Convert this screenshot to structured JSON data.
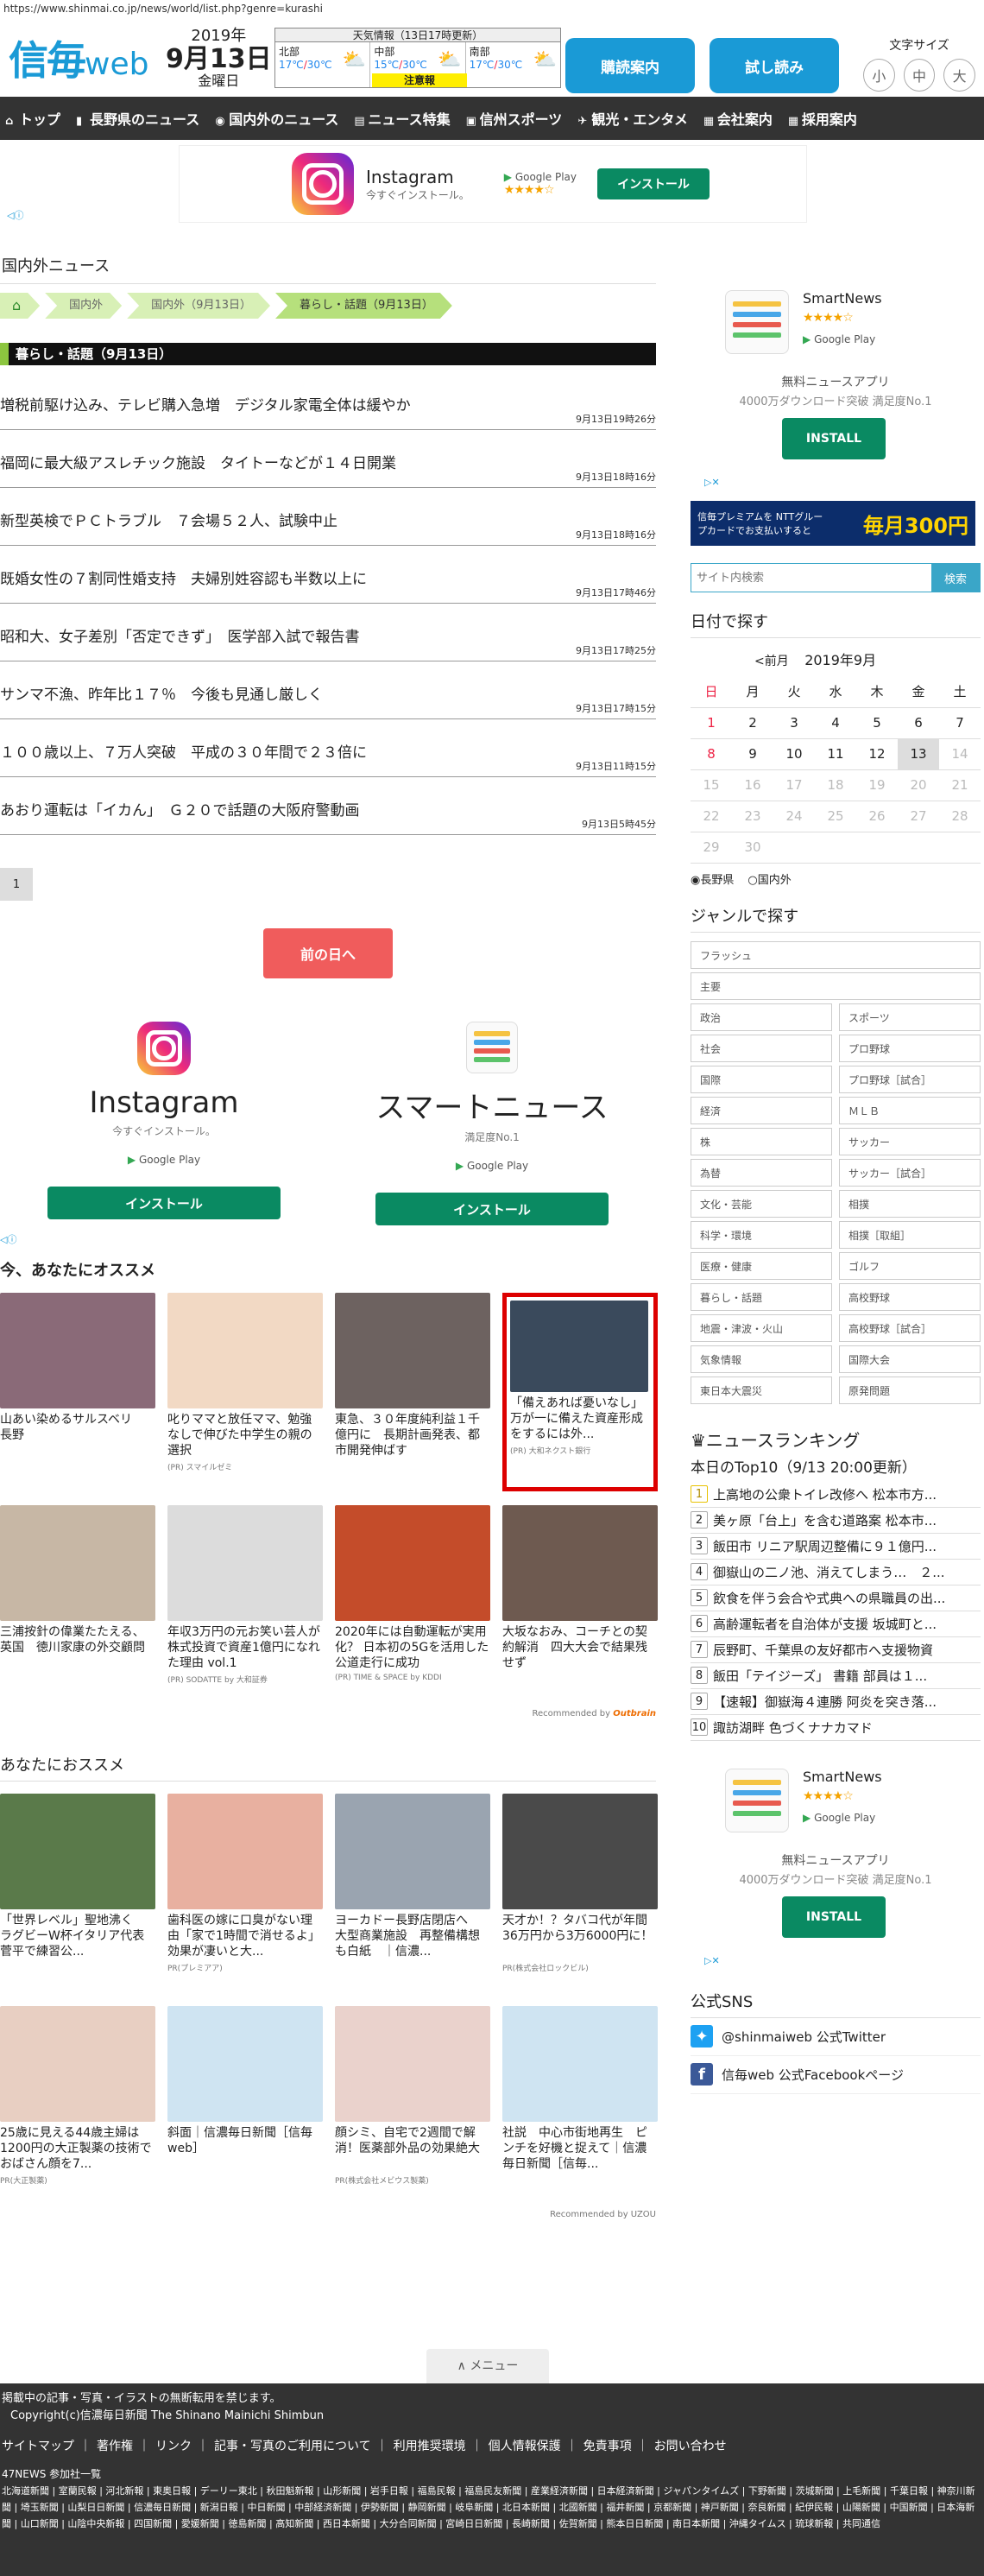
{
  "url": "https://www.shinmai.co.jp/news/world/list.php?genre=kurashi",
  "header": {
    "logo_main": "信毎",
    "logo_sub": "web",
    "year": "2019年",
    "monthday": "9月13日",
    "weekday": "金曜日",
    "weather_title": "天気情報（13日17時更新）",
    "weather": [
      {
        "area": "北部",
        "hi": "17℃",
        "lo": "30℃"
      },
      {
        "area": "中部",
        "hi": "15℃",
        "lo": "30℃"
      },
      {
        "area": "南部",
        "hi": "17℃",
        "lo": "30℃"
      }
    ],
    "weather_alert": "注意報",
    "btn_subscribe": "購読案内",
    "btn_trial": "試し読み",
    "fontsize_label": "文字サイズ",
    "fontsize_small": "小",
    "fontsize_mid": "中",
    "fontsize_large": "大"
  },
  "nav": [
    "トップ",
    "長野県のニュース",
    "国内外のニュース",
    "ニュース特集",
    "信州スポーツ",
    "観光・エンタメ",
    "会社案内",
    "採用案内"
  ],
  "banner_ad": {
    "name": "Instagram",
    "desc": "今すぐインストール。",
    "store": "Google Play",
    "rating": "★★★★☆",
    "install": "インストール"
  },
  "main": {
    "section_title": "国内外ニュース",
    "breadcrumbs": [
      "⌂",
      "国内外",
      "国内外（9月13日）",
      "暮らし・話題（9月13日）"
    ],
    "category_heading": "暮らし・話題（9月13日）",
    "news": [
      {
        "title": "増税前駆け込み、テレビ購入急増　デジタル家電全体は緩やか",
        "time": "9月13日19時26分"
      },
      {
        "title": "福岡に最大級アスレチック施設　タイトーなどが１４日開業",
        "time": "9月13日18時16分"
      },
      {
        "title": "新型英検でＰＣトラブル　７会場５２人、試験中止",
        "time": "9月13日18時16分"
      },
      {
        "title": "既婚女性の７割同性婚支持　夫婦別姓容認も半数以上に",
        "time": "9月13日17時46分"
      },
      {
        "title": "昭和大、女子差別「否定できず」　医学部入試で報告書",
        "time": "9月13日17時25分"
      },
      {
        "title": "サンマ不漁、昨年比１７％　今後も見通し厳しく",
        "time": "9月13日17時15分"
      },
      {
        "title": "１００歳以上、７万人突破　平成の３０年間で２３倍に",
        "time": "9月13日11時15分"
      },
      {
        "title": "あおり運転は「イカん」　Ｇ２０で話題の大阪府警動画",
        "time": "9月13日5時45分"
      }
    ],
    "page": "1",
    "prev_day": "前の日へ",
    "twin_ads": [
      {
        "name": "Instagram",
        "desc": "今すぐインストール。",
        "store": "Google Play",
        "install": "インストール"
      },
      {
        "name": "スマートニュース",
        "desc": "満足度No.1",
        "store": "Google Play",
        "install": "インストール"
      }
    ],
    "recommend_title": "今、あなたにオススメ",
    "recommend": [
      {
        "text": "山あい染めるサルスベリ　長野",
        "pr": "",
        "color": "#8a6a78"
      },
      {
        "text": "叱りママと放任ママ、勉強なしで伸びた中学生の親の選択",
        "pr": "(PR) スマイルゼミ",
        "color": "#f2d9c4"
      },
      {
        "text": "東急、３０年度純利益１千億円に　長期計画発表、都市開発伸ばす",
        "pr": "",
        "color": "#6d6260"
      },
      {
        "text": "「備えあれば憂いなし」万が一に備えた資産形成をするには外...",
        "pr": "(PR) 大和ネクスト銀行",
        "color": "#3a4a5c"
      },
      {
        "text": "三浦按針の偉業たたえる、英国　徳川家康の外交顧問",
        "pr": "",
        "color": "#c7b7a5"
      },
      {
        "text": "年収3万円の元お笑い芸人が株式投資で資産1億円になれた理由 vol.1",
        "pr": "(PR) SODATTE by 大和証券",
        "color": "#dcdcdc"
      },
      {
        "text": "2020年には自動運転が実用化？ 日本初の5Gを活用した公道走行に成功",
        "pr": "(PR) TIME & SPACE by KDDI",
        "color": "#c44c2a"
      },
      {
        "text": "大坂なおみ、コーチとの契約解消　四大大会で結果残せず",
        "pr": "",
        "color": "#6e5a50"
      }
    ],
    "recommended_by": "Recommended by",
    "outbrain": "Outbrain",
    "recommend2_title": "あなたにおススメ",
    "recommend2": [
      {
        "text": "「世界レベル」聖地沸く　ラグビーW杯イタリア代表　菅平で練習公...",
        "pr": "",
        "color": "#5a7a4a"
      },
      {
        "text": "歯科医の嫁に口臭がない理由「家で1時間で消せるよ」効果が凄いと大...",
        "pr": "PR(プレミアア)",
        "color": "#e8b0a0"
      },
      {
        "text": "ヨーカドー長野店閉店へ　大型商業施設　再整備構想も白紙　｜信濃...",
        "pr": "",
        "color": "#9aa4b0"
      },
      {
        "text": "天才か！？タバコ代が年間36万円から3万6000円に！",
        "pr": "PR(株式会社ロックビル)",
        "color": "#4a4a4a"
      },
      {
        "text": "25歳に見える44歳主婦は1200円の大正製薬の技術でおばさん顔を7...",
        "pr": "PR(大正製薬)",
        "color": "#e8cfc2"
      },
      {
        "text": "斜面｜信濃毎日新聞［信毎web］",
        "pr": "",
        "color": "#cfe4f2"
      },
      {
        "text": "顔シミ、自宅で2週間で解消！医薬部外品の効果絶大",
        "pr": "PR(株式会社メビウス製薬)",
        "color": "#ead2cc"
      },
      {
        "text": "社説　中心市街地再生　ピンチを好機と捉えて｜信濃毎日新聞［信毎...",
        "pr": "",
        "color": "#cfe4f2"
      }
    ],
    "uzou": "Recommended by UZOU",
    "menu": "∧ メニュー"
  },
  "side": {
    "sn_name": "SmartNews",
    "sn_rating": "★★★★☆",
    "sn_store": "Google Play",
    "sn_desc1": "無料ニュースアプリ",
    "sn_desc2": "4000万ダウンロード突破 満足度No.1",
    "sn_install": "INSTALL",
    "premium_text": "信毎プレミアムを NTTグループカードでお支払いすると",
    "premium_big": "毎月300円",
    "search_placeholder": "サイト内検索",
    "search_button": "検索",
    "calendar_title": "日付で探す",
    "cal_prev": "<前月",
    "cal_month": "2019年9月",
    "cal_days": [
      "日",
      "月",
      "火",
      "水",
      "木",
      "金",
      "土"
    ],
    "cal_rows": [
      [
        "1",
        "2",
        "3",
        "4",
        "5",
        "6",
        "7"
      ],
      [
        "8",
        "9",
        "10",
        "11",
        "12",
        "13",
        "14"
      ],
      [
        "15",
        "16",
        "17",
        "18",
        "19",
        "20",
        "21"
      ],
      [
        "22",
        "23",
        "24",
        "25",
        "26",
        "27",
        "28"
      ],
      [
        "29",
        "30",
        "",
        "",
        "",
        "",
        ""
      ]
    ],
    "radio_nagano": "長野県",
    "radio_world": "国内外",
    "genre_title": "ジャンルで探す",
    "genres_full": [
      "フラッシュ",
      "主要"
    ],
    "genres": [
      "政治",
      "スポーツ",
      "社会",
      "プロ野球",
      "国際",
      "プロ野球［試合］",
      "経済",
      "ＭＬＢ",
      "株",
      "サッカー",
      "為替",
      "サッカー［試合］",
      "文化・芸能",
      "相撲",
      "科学・環境",
      "相撲［取組］",
      "医療・健康",
      "ゴルフ",
      "暮らし・話題",
      "高校野球",
      "地震・津波・火山",
      "高校野球［試合］",
      "気象情報",
      "国際大会",
      "東日本大震災",
      "原発問題"
    ],
    "ranking_title": "♛ニュースランキング",
    "ranking_sub": "本日のTop10（9/13 20:00更新）",
    "ranking": [
      "上高地の公衆トイレ改修へ 松本市方...",
      "美ヶ原「台上」を含む道路案 松本市...",
      "飯田市 リニア駅周辺整備に９１億円...",
      "御嶽山の二ノ池、消えてしまう…　２...",
      "飲食を伴う会合や式典への県職員の出...",
      "高齢運転者を自治体が支援 坂城町と...",
      "辰野町、千葉県の友好都市へ支援物資",
      "飯田「テイジーズ」 書籍 部員は１...",
      "【速報】御嶽海４連勝 阿炎を突き落...",
      "諏訪湖畔 色づくナナカマド"
    ],
    "sns_title": "公式SNS",
    "twitter": "@shinmaiweb 公式Twitter",
    "facebook": "信毎web 公式Facebookページ"
  },
  "footer": {
    "notice": "掲載中の記事・写真・イラストの無断転用を禁じます。",
    "copyright": "Copyright(c)信濃毎日新聞 The Shinano Mainichi Shimbun",
    "links": [
      "サイトマップ",
      "著作権",
      "リンク",
      "記事・写真のご利用について",
      "利用推奨環境",
      "個人情報保護",
      "免責事項",
      "お問い合わせ"
    ],
    "n47": "47NEWS 参加社一覧",
    "papers": "北海道新聞 | 室蘭民報 | 河北新報 | 東奥日報 | デーリー東北 | 秋田魁新報 | 山形新聞 | 岩手日報 | 福島民報 | 福島民友新聞 | 産業経済新聞 | 日本経済新聞 | ジャパンタイムズ | 下野新聞 | 茨城新聞 | 上毛新聞 | 千葉日報 | 神奈川新聞 | 埼玉新聞 | 山梨日日新聞 | 信濃毎日新聞 | 新潟日報 | 中日新聞 | 中部経済新聞 | 伊勢新聞 | 静岡新聞 | 岐阜新聞 | 北日本新聞 | 北國新聞 | 福井新聞 | 京都新聞 | 神戸新聞 | 奈良新聞 | 紀伊民報 | 山陽新聞 | 中国新聞 | 日本海新聞 | 山口新聞 | 山陰中央新報 | 四国新聞 | 愛媛新聞 | 徳島新聞 | 高知新聞 | 西日本新聞 | 大分合同新聞 | 宮崎日日新聞 | 長崎新聞 | 佐賀新聞 | 熊本日日新聞 | 南日本新聞 | 沖縄タイムス | 琉球新報 | 共同通信"
  }
}
